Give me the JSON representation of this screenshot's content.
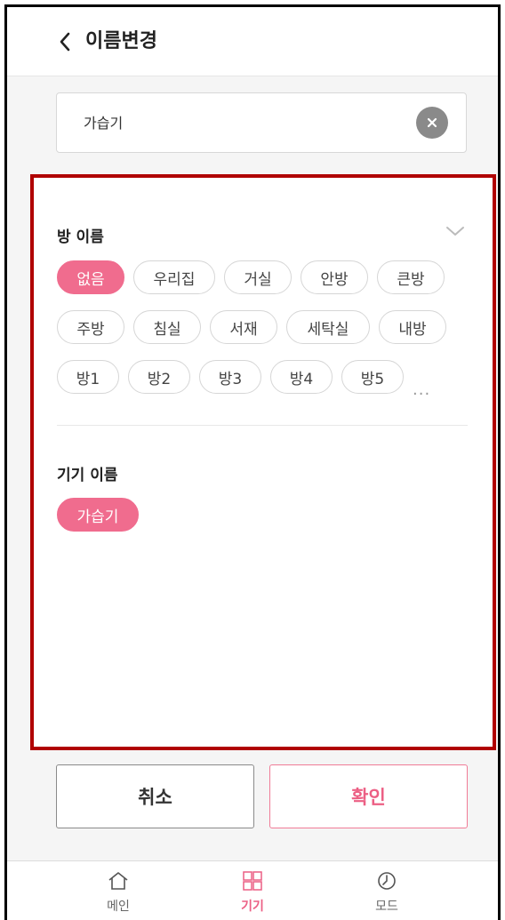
{
  "header": {
    "title": "이름변경",
    "back_icon": "chevron-left-icon"
  },
  "search": {
    "value": "가습기",
    "clear_icon": "close-icon"
  },
  "room": {
    "label": "방 이름",
    "expand_icon": "chevron-down-icon",
    "chips": [
      "없음",
      "우리집",
      "거실",
      "안방",
      "큰방",
      "주방",
      "침실",
      "서재",
      "세탁실",
      "내방",
      "방1",
      "방2",
      "방3",
      "방4",
      "방5"
    ],
    "selected": "없음",
    "more": "..."
  },
  "device": {
    "label": "기기 이름",
    "chips": [
      "가습기"
    ],
    "selected": "가습기"
  },
  "actions": {
    "cancel": "취소",
    "confirm": "확인"
  },
  "tabs": [
    {
      "label": "메인",
      "icon": "home-icon",
      "active": false
    },
    {
      "label": "기기",
      "icon": "grid-icon",
      "active": true
    },
    {
      "label": "모드",
      "icon": "clock-icon",
      "active": false
    }
  ],
  "colors": {
    "accent": "#f06c8e",
    "panel_border": "#b00000"
  }
}
